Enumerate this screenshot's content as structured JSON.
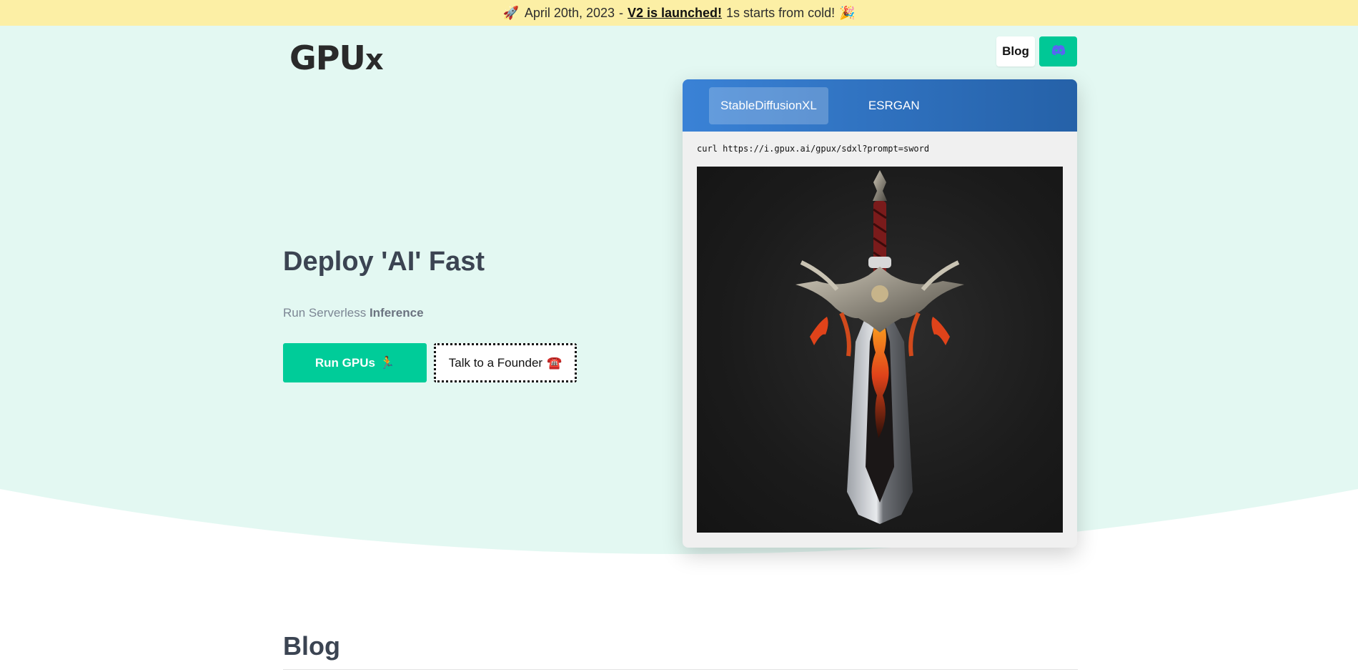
{
  "announcement": {
    "rocket_emoji": "🚀",
    "date": "April 20th, 2023",
    "separator": "-",
    "link_text": "V2 is launched!",
    "message": "1s starts from cold!",
    "party_emoji": "🎉"
  },
  "header": {
    "logo_text_main": "GPU",
    "logo_text_x": "x",
    "nav_blog": "Blog",
    "nav_discord_icon": "discord-icon"
  },
  "hero": {
    "title": "Deploy 'AI' Fast",
    "subtitle_prefix": "Run Serverless",
    "subtitle_bold": "Inference",
    "primary_cta": "Run GPUs",
    "primary_cta_emoji": "🏃",
    "secondary_cta": "Talk to a Founder",
    "secondary_cta_emoji": "☎️"
  },
  "demo": {
    "tabs": [
      {
        "label": "StableDiffusionXL",
        "active": true
      },
      {
        "label": "ESRGAN",
        "active": false
      }
    ],
    "command": "curl https://i.gpux.ai/gpux/sdxl?prompt=sword",
    "image_subject": "generated sword image"
  },
  "blog": {
    "heading": "Blog"
  },
  "colors": {
    "announce_bg": "#fcefa5",
    "hero_bg": "#e3f8f2",
    "accent": "#00cc99",
    "demo_header_start": "#3a82d6",
    "demo_header_end": "#2561a8"
  }
}
